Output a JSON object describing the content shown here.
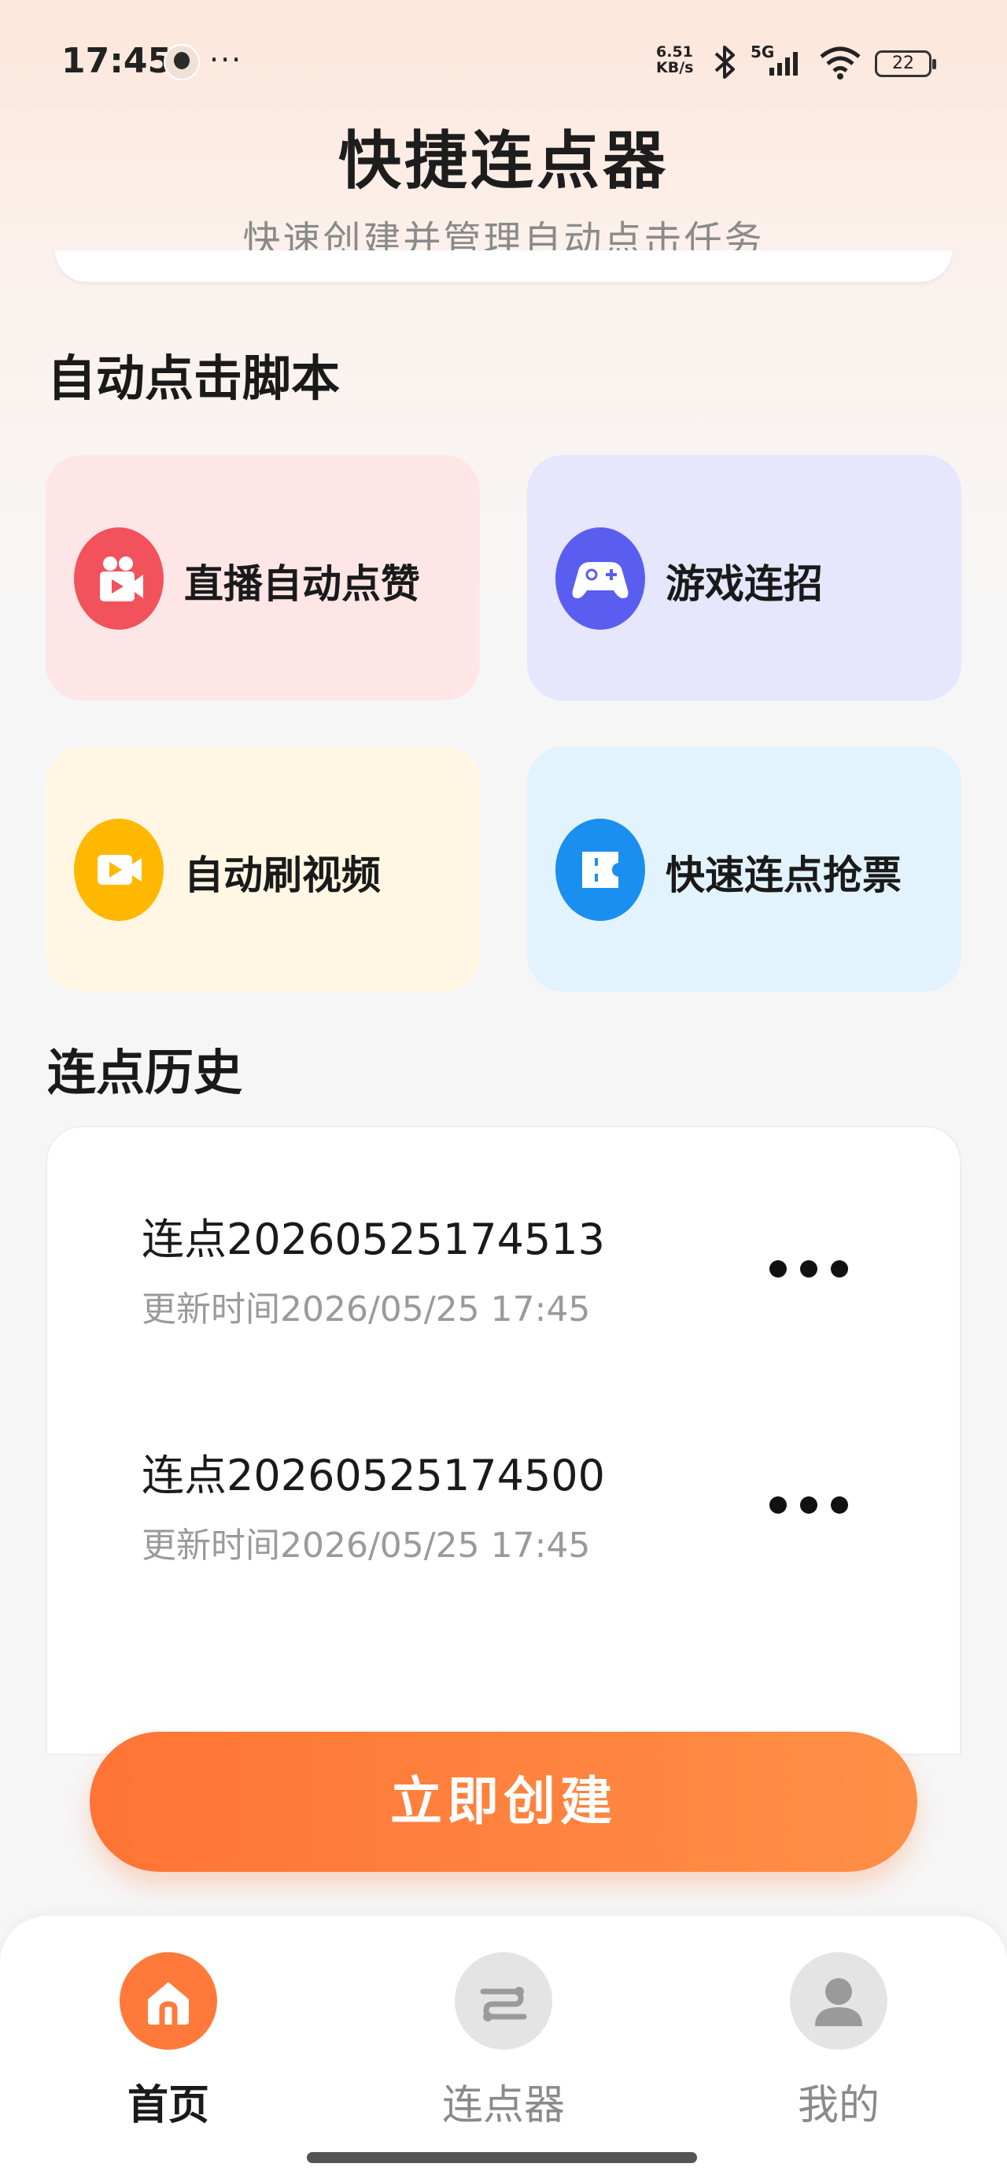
{
  "status": {
    "time": "17:45",
    "more": "···",
    "net_speed_value": "6.51",
    "net_speed_unit": "KB/s",
    "signal_label": "5G",
    "battery": "22"
  },
  "header": {
    "title": "快捷连点器",
    "subtitle": "快速创建并管理自动点击任务"
  },
  "scripts": {
    "title": "自动点击脚本",
    "items": [
      {
        "label": "直播自动点赞",
        "icon": "live-camera-icon",
        "bg": "#ffe6e6",
        "icon_bg": "#f2525b"
      },
      {
        "label": "游戏连招",
        "icon": "gamepad-icon",
        "bg": "#e6e6fd",
        "icon_bg": "#5a5ef0"
      },
      {
        "label": "自动刷视频",
        "icon": "video-play-icon",
        "bg": "#fff7e4",
        "icon_bg": "#ffb800"
      },
      {
        "label": "快速连点抢票",
        "icon": "ticket-icon",
        "bg": "#e3f3fd",
        "icon_bg": "#1a8ff0"
      }
    ]
  },
  "history": {
    "title": "连点历史",
    "items": [
      {
        "name": "连点20260525174513",
        "updated": "更新时间2026/05/25 17:45"
      },
      {
        "name": "连点20260525174500",
        "updated": "更新时间2026/05/25 17:45"
      }
    ]
  },
  "create_button": "立即创建",
  "tabs": [
    {
      "label": "首页",
      "icon": "home-icon",
      "active": true
    },
    {
      "label": "连点器",
      "icon": "clicker-icon",
      "active": false
    },
    {
      "label": "我的",
      "icon": "user-icon",
      "active": false
    }
  ],
  "colors": {
    "accent": "#ff7a3a",
    "inactive": "#8a8a8a"
  }
}
